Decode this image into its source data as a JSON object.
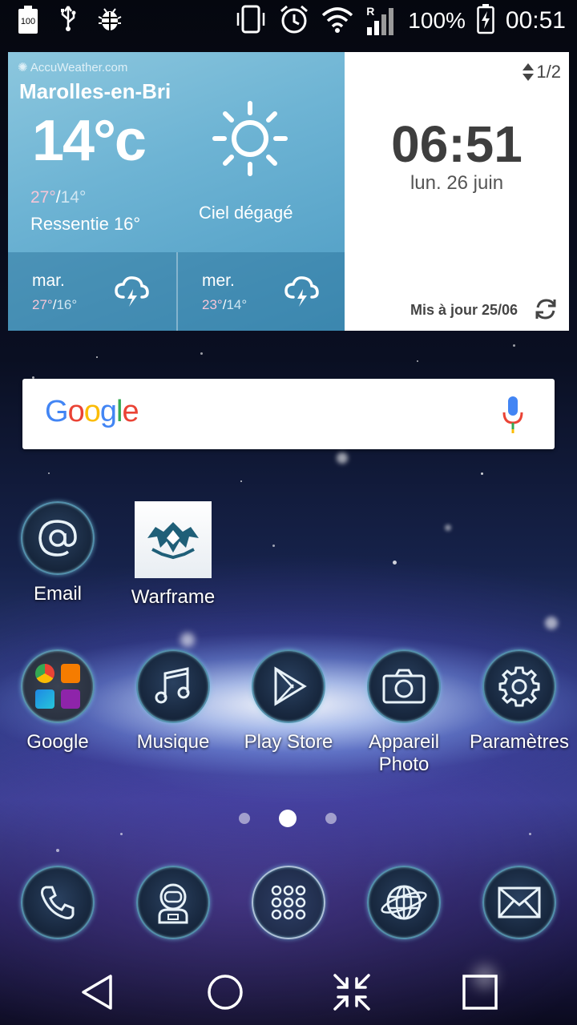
{
  "status_bar": {
    "battery_box_label": "100",
    "battery_percent": "100%",
    "time": "00:51",
    "icons": [
      "battery-icon",
      "usb-icon",
      "debug-icon",
      "vibrate-icon",
      "alarm-icon",
      "wifi-icon",
      "signal-icon",
      "charging-icon"
    ],
    "roaming": "R"
  },
  "weather": {
    "brand": "AccuWeather.com",
    "city": "Marolles-en-Brie",
    "temp": "14°c",
    "high": "27°",
    "low": "14°",
    "feels_like": "Ressentie 16°",
    "condition": "Ciel dégagé",
    "forecast": [
      {
        "day": "mar.",
        "high": "27°",
        "low": "16°",
        "icon": "storm-cloud-icon"
      },
      {
        "day": "mer.",
        "high": "23°",
        "low": "14°",
        "icon": "storm-cloud-icon"
      }
    ]
  },
  "clock": {
    "page": "1/2",
    "time": "06:51",
    "date": "lun. 26 juin",
    "updated": "Mis à jour 25/06"
  },
  "search": {
    "logo": "Google"
  },
  "apps_row1": [
    {
      "label": "Email",
      "icon": "at-icon"
    },
    {
      "label": "Warframe",
      "icon": "warframe-logo-icon"
    }
  ],
  "apps_row2": [
    {
      "label": "Google",
      "icon": "google-folder-icon"
    },
    {
      "label": "Musique",
      "icon": "music-note-icon"
    },
    {
      "label": "Play Store",
      "icon": "play-store-icon"
    },
    {
      "label": "Appareil Photo",
      "icon": "camera-icon"
    },
    {
      "label": "Paramètres",
      "icon": "gear-icon"
    }
  ],
  "dock": [
    "phone-icon",
    "contacts-icon",
    "app-drawer-icon",
    "browser-globe-icon",
    "mail-icon"
  ],
  "page_indicator": {
    "pages": 3,
    "current": 2
  },
  "colors": {
    "weather_bg": "#6eb4d4",
    "clock_bg": "#ffffff",
    "icon_ring": "#6ebedc",
    "google_blue": "#4285F4",
    "google_red": "#EA4335",
    "google_yellow": "#FBBC05",
    "google_green": "#34A853"
  }
}
